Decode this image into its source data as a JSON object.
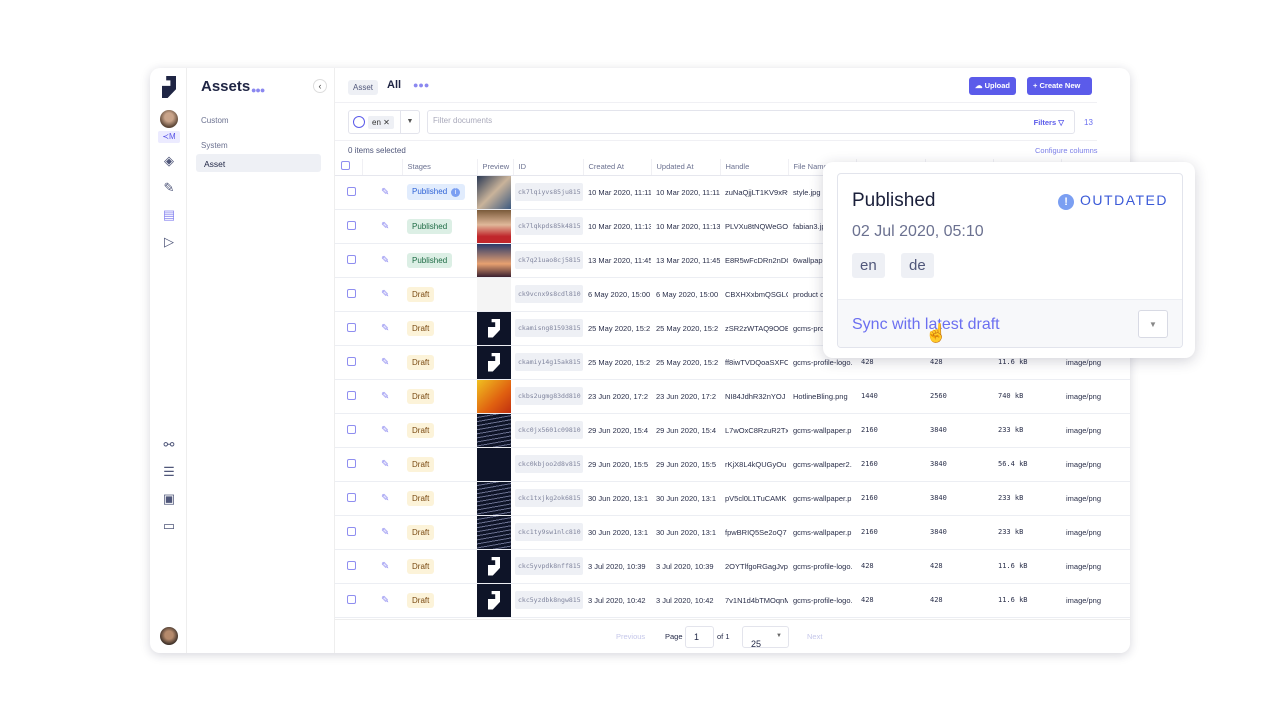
{
  "sidebar": {
    "title": "Assets",
    "sections": {
      "custom": "Custom",
      "system": "System"
    },
    "items": [
      {
        "label": "Asset",
        "active": true
      }
    ],
    "env_tag": "≺M"
  },
  "header": {
    "tab_model": "Asset",
    "tab_view": "All",
    "upload": "Upload",
    "create": "Create New"
  },
  "filters": {
    "locale": "en",
    "placeholder": "Filter documents",
    "filters_label": "Filters",
    "count": "13"
  },
  "table": {
    "selected": "0 items selected",
    "configure": "Configure columns",
    "columns": [
      "Stages",
      "Preview",
      "ID",
      "Created At",
      "Updated At",
      "Handle",
      "File Name"
    ],
    "rows": [
      {
        "stage": "Published",
        "stage_type": "published-info",
        "thumb": "photo-hands",
        "id": "ck7lqiyvs85ju815",
        "created": "10 Mar 2020, 11:11",
        "updated": "10 Mar 2020, 11:11",
        "handle": "zuNaQjjLT1KV9xRt",
        "file": "style.jpg",
        "height": "",
        "width": "",
        "size": "",
        "mime": ""
      },
      {
        "stage": "Published",
        "stage_type": "published",
        "thumb": "photo-man",
        "id": "ck7lqkpds85k4815",
        "created": "10 Mar 2020, 11:13",
        "updated": "10 Mar 2020, 11:13",
        "handle": "PLVXu8tNQWeGO",
        "file": "fabian3.jpg",
        "height": "",
        "width": "",
        "size": "",
        "mime": ""
      },
      {
        "stage": "Published",
        "stage_type": "published",
        "thumb": "photo-paris",
        "id": "ck7q21uao8cj5815",
        "created": "13 Mar 2020, 11:45",
        "updated": "13 Mar 2020, 11:45",
        "handle": "E8R5wFcDRn2nDC",
        "file": "6wallpaper",
        "height": "",
        "width": "",
        "size": "",
        "mime": ""
      },
      {
        "stage": "Draft",
        "stage_type": "draft",
        "thumb": "doc",
        "id": "ck9vcnx9s8cdl810",
        "created": "6 May 2020, 15:00",
        "updated": "6 May 2020, 15:00",
        "handle": "CBXHXxbmQSGLC",
        "file": "product o",
        "height": "",
        "width": "",
        "size": "",
        "mime": ""
      },
      {
        "stage": "Draft",
        "stage_type": "draft",
        "thumb": "logo",
        "id": "ckamisng81593815",
        "created": "25 May 2020, 15:2",
        "updated": "25 May 2020, 15:2",
        "handle": "zSR2zWTAQ9OOB",
        "file": "gcms-pro",
        "height": "",
        "width": "",
        "size": "",
        "mime": ""
      },
      {
        "stage": "Draft",
        "stage_type": "draft",
        "thumb": "logo",
        "id": "ckamiy14g15ak815",
        "created": "25 May 2020, 15:2",
        "updated": "25 May 2020, 15:2",
        "handle": "ff8iwTVDQoaSXFC",
        "file": "gcms-profile-logo.",
        "height": "428",
        "width": "428",
        "size": "11.6 kB",
        "mime": "image/png"
      },
      {
        "stage": "Draft",
        "stage_type": "draft",
        "thumb": "photo-orange",
        "id": "ckbs2ugmg83dd810",
        "created": "23 Jun 2020, 17:2",
        "updated": "23 Jun 2020, 17:2",
        "handle": "NI84JdhR32nYOJ",
        "file": "HotlineBling.png",
        "height": "1440",
        "width": "2560",
        "size": "740 kB",
        "mime": "image/png"
      },
      {
        "stage": "Draft",
        "stage_type": "draft",
        "thumb": "pattern",
        "id": "ckc0jx5601c09810",
        "created": "29 Jun 2020, 15:4",
        "updated": "29 Jun 2020, 15:4",
        "handle": "L7wOxC8RzuR2Tx",
        "file": "gcms-wallpaper.p",
        "height": "2160",
        "width": "3840",
        "size": "233 kB",
        "mime": "image/png"
      },
      {
        "stage": "Draft",
        "stage_type": "draft",
        "thumb": "dark",
        "id": "ckc0kbjoo2d8v815",
        "created": "29 Jun 2020, 15:5",
        "updated": "29 Jun 2020, 15:5",
        "handle": "rKjX8L4kQUGyOu",
        "file": "gcms-wallpaper2.",
        "height": "2160",
        "width": "3840",
        "size": "56.4 kB",
        "mime": "image/png"
      },
      {
        "stage": "Draft",
        "stage_type": "draft",
        "thumb": "pattern",
        "id": "ckc1txjkg2ok6815",
        "created": "30 Jun 2020, 13:1",
        "updated": "30 Jun 2020, 13:1",
        "handle": "pV5cl0L1TuCAMK",
        "file": "gcms-wallpaper.p",
        "height": "2160",
        "width": "3840",
        "size": "233 kB",
        "mime": "image/png"
      },
      {
        "stage": "Draft",
        "stage_type": "draft",
        "thumb": "pattern",
        "id": "ckc1ty9sw1nlc810",
        "created": "30 Jun 2020, 13:1",
        "updated": "30 Jun 2020, 13:1",
        "handle": "fpwBRIQ5Se2oQ7",
        "file": "gcms-wallpaper.p",
        "height": "2160",
        "width": "3840",
        "size": "233 kB",
        "mime": "image/png"
      },
      {
        "stage": "Draft",
        "stage_type": "draft",
        "thumb": "logo",
        "id": "ckc5yvpdk8nff815",
        "created": "3 Jul 2020, 10:39",
        "updated": "3 Jul 2020, 10:39",
        "handle": "2OYTlfgoRGagJvp",
        "file": "gcms-profile-logo.",
        "height": "428",
        "width": "428",
        "size": "11.6 kB",
        "mime": "image/png"
      },
      {
        "stage": "Draft",
        "stage_type": "draft",
        "thumb": "logo",
        "id": "ckc5yzdbk8ngw815",
        "created": "3 Jul 2020, 10:42",
        "updated": "3 Jul 2020, 10:42",
        "handle": "7v1N1d4bTMOqnM",
        "file": "gcms-profile-logo.",
        "height": "428",
        "width": "428",
        "size": "11.6 kB",
        "mime": "image/png"
      }
    ]
  },
  "pagination": {
    "previous": "Previous",
    "page_label": "Page",
    "page": "1",
    "of": "of 1",
    "per_page": "25",
    "next": "Next"
  },
  "popover": {
    "title": "Published",
    "status": "OUTDATED",
    "date": "02 Jul 2020, 05:10",
    "locales": [
      "en",
      "de"
    ],
    "action": "Sync with latest draft"
  },
  "colors": {
    "accent": "#5b5bea",
    "outdated": "#3c5bd8"
  }
}
